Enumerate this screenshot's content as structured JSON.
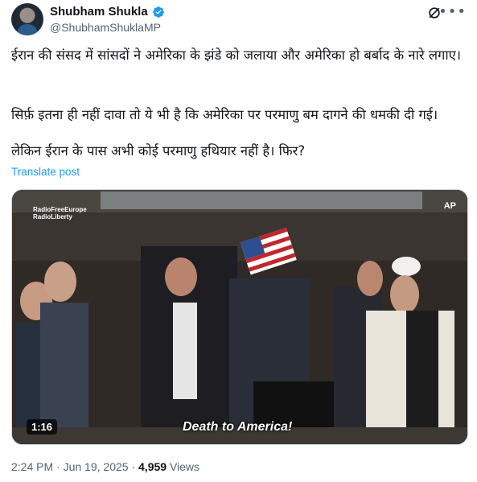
{
  "author": {
    "name": "Shubham Shukla",
    "handle": "@ShubhamShuklaMP",
    "avatar_icon": "avatar"
  },
  "icons": {
    "verified": "verified-badge-icon",
    "grok": "grok-icon",
    "more": "more-options-icon"
  },
  "post": {
    "paragraph_1": "ईरान की संसद में सांसदों ने अमेरिका के झंडे को जलाया और अमेरिका हो बर्बाद के नारे लगाए।",
    "paragraph_2": "सिर्फ़ इतना ही नहीं दावा तो ये भी है कि अमेरिका पर परमाणु बम दागने की धमकी दी गई।",
    "paragraph_3": "लेकिन ईरान के पास अभी कोई परमाणु हथियार नहीं है। फिर?",
    "translate_label": "Translate post"
  },
  "video": {
    "logo_line_1": "RadioFreeEurope",
    "logo_line_2": "RadioLiberty",
    "watermark": "AP",
    "duration": "1:16",
    "subtitle": "Death to America!"
  },
  "meta": {
    "time": "2:24 PM",
    "separator": "·",
    "date": "Jun 19, 2025",
    "views_count": "4,959",
    "views_label": "Views"
  },
  "colors": {
    "link": "#1d9bf0",
    "verified": "#1d9bf0",
    "muted": "#536471"
  }
}
